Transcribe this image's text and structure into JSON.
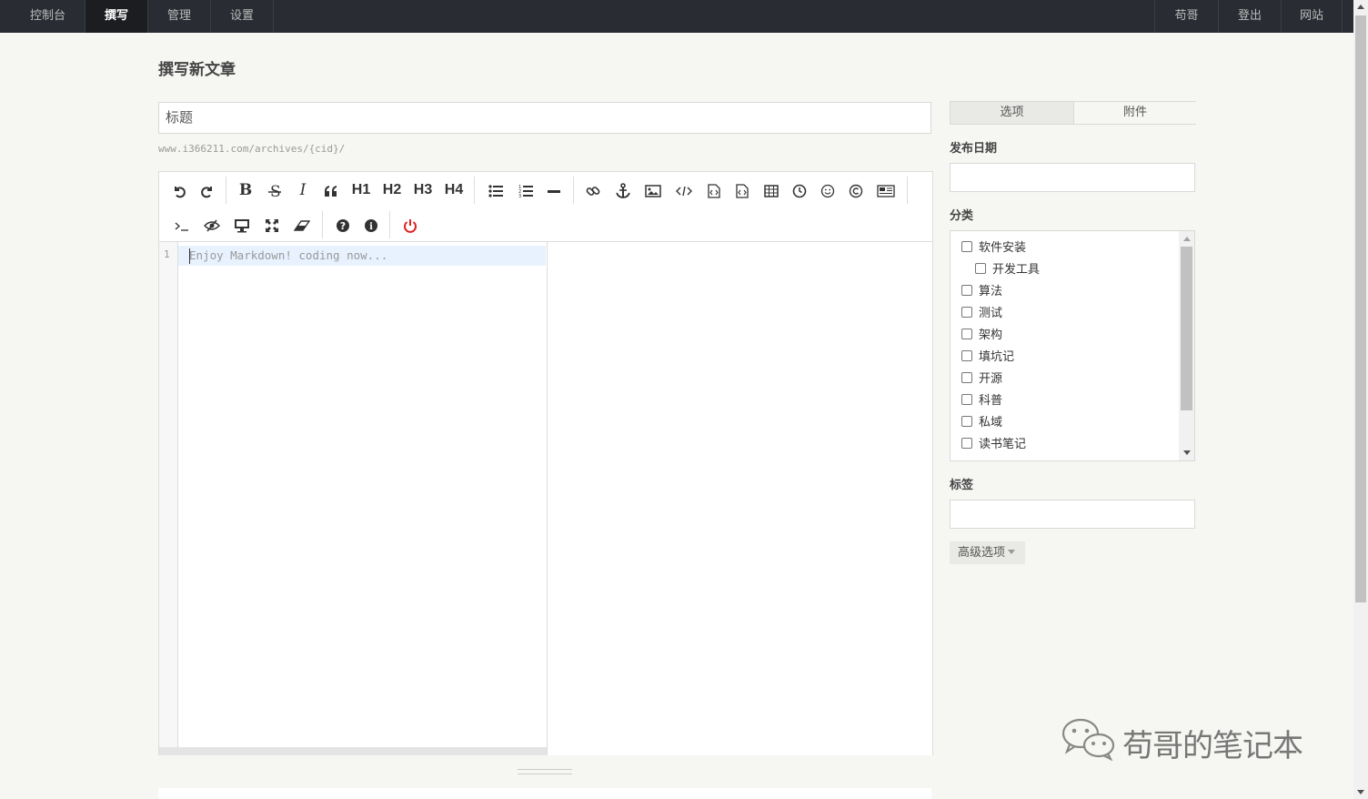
{
  "nav": {
    "left": [
      "控制台",
      "撰写",
      "管理",
      "设置"
    ],
    "active": "撰写",
    "right": [
      "苟哥",
      "登出",
      "网站"
    ]
  },
  "page": {
    "title": "撰写新文章",
    "title_placeholder": "标题",
    "url_hint": "www.i366211.com/archives/{cid}/"
  },
  "editor": {
    "toolbar_row1": [
      "undo-icon",
      "redo-icon",
      "B",
      "strikethrough-icon",
      "I",
      "quote-icon",
      "H1",
      "H2",
      "H3",
      "H4",
      "list-ul-icon",
      "list-ol-icon",
      "hr-icon",
      "link-icon",
      "anchor-icon",
      "image-icon",
      "code-icon",
      "code-block-icon",
      "code-block-alt-icon",
      "table-icon",
      "clock-icon",
      "emoji-icon",
      "copyright-icon",
      "newspaper-icon"
    ],
    "toolbar_row2": [
      "terminal-icon",
      "eye-slash-icon",
      "desktop-icon",
      "fullscreen-icon",
      "eraser-icon",
      "help-icon",
      "info-icon",
      "power-icon"
    ],
    "heading_labels": {
      "h1": "H1",
      "h2": "H2",
      "h3": "H3",
      "h4": "H4",
      "bold": "B",
      "italic": "I"
    },
    "line_number": "1",
    "placeholder": "Enjoy Markdown! coding now...",
    "power_color": "#e01f1f"
  },
  "sidebar": {
    "tabs": [
      "选项",
      "附件"
    ],
    "active_tab": "选项",
    "publish_date_label": "发布日期",
    "category_label": "分类",
    "categories": [
      {
        "label": "软件安装",
        "indent": 0
      },
      {
        "label": "开发工具",
        "indent": 1
      },
      {
        "label": "算法",
        "indent": 0
      },
      {
        "label": "测试",
        "indent": 0
      },
      {
        "label": "架构",
        "indent": 0
      },
      {
        "label": "填坑记",
        "indent": 0
      },
      {
        "label": "开源",
        "indent": 0
      },
      {
        "label": "科普",
        "indent": 0
      },
      {
        "label": "私域",
        "indent": 0
      },
      {
        "label": "读书笔记",
        "indent": 0
      }
    ],
    "tags_label": "标签",
    "advanced_label": "高级选项"
  },
  "watermark": "苟哥的笔记本",
  "colors": {
    "nav_bg": "#292d33",
    "page_bg": "#f6f6f3",
    "active_line": "#e8f2fe"
  }
}
